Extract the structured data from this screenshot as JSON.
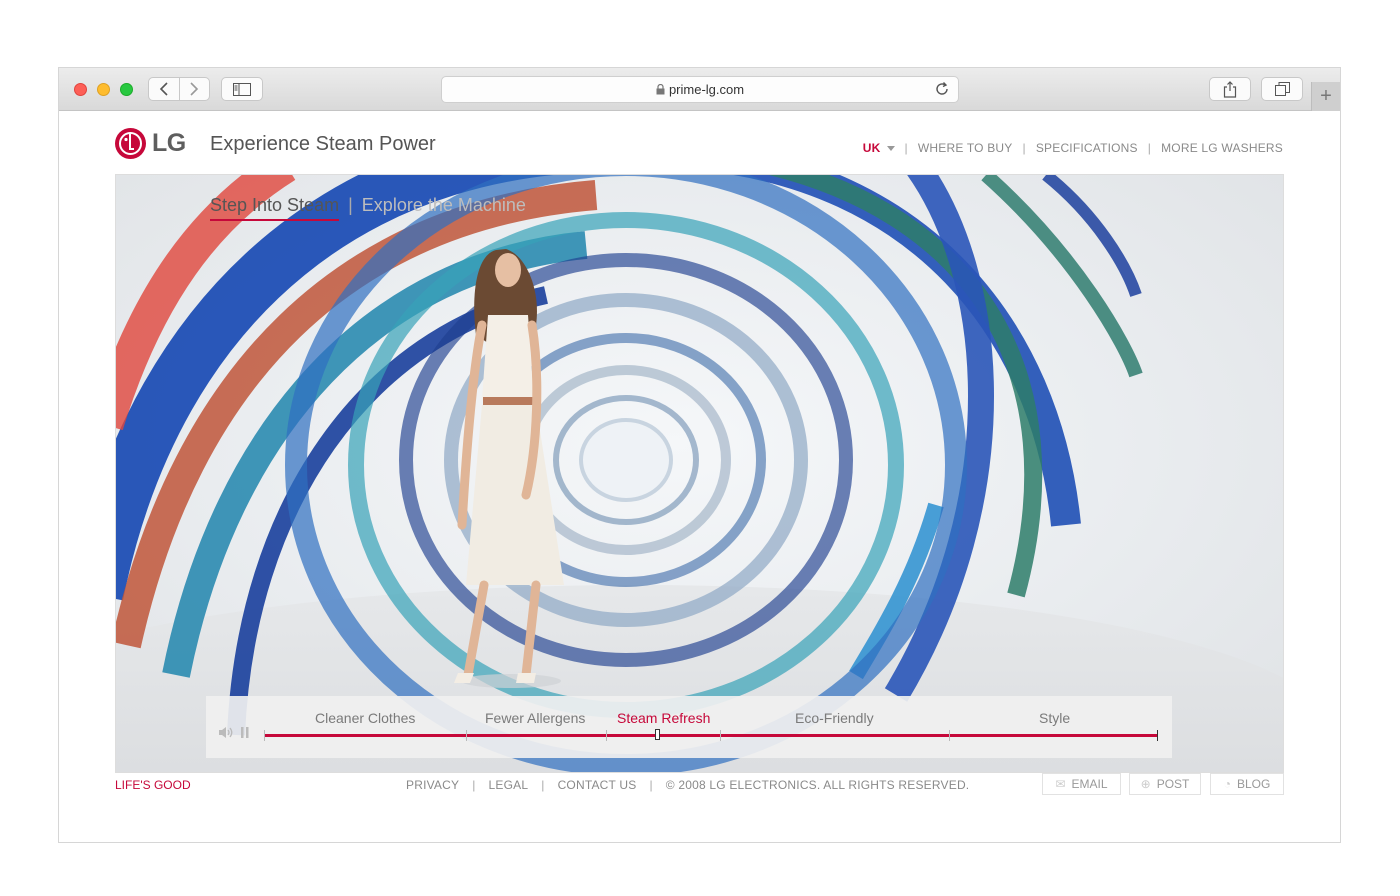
{
  "browser": {
    "url": "prime-lg.com"
  },
  "header": {
    "brand": "LG",
    "title": "Experience Steam Power",
    "region": "UK",
    "nav": [
      "WHERE TO BUY",
      "SPECIFICATIONS",
      "MORE LG WASHERS"
    ]
  },
  "hero": {
    "breadcrumb_active": "Step Into Steam",
    "breadcrumb_sep": "|",
    "breadcrumb_inactive": "Explore the Machine"
  },
  "player": {
    "chapters": [
      "Cleaner Clothes",
      "Fewer Allergens",
      "Steam Refresh",
      "Eco-Friendly",
      "Style"
    ],
    "active_chapter": "Steam Refresh",
    "progress": 0.44,
    "accent": "#c6083a"
  },
  "footer": {
    "tagline": "LIFE'S GOOD",
    "links": [
      "PRIVACY",
      "LEGAL",
      "CONTACT US"
    ],
    "copyright": "© 2008 LG ELECTRONICS. ALL RIGHTS RESERVED.",
    "social": [
      "EMAIL",
      "POST",
      "BLOG"
    ]
  },
  "icons": [
    "back-icon",
    "forward-icon",
    "sidebar-icon",
    "lock-icon",
    "reload-icon",
    "share-icon",
    "tabs-icon",
    "plus-icon",
    "volume-icon",
    "pause-icon",
    "email-icon",
    "post-icon",
    "blog-icon"
  ]
}
